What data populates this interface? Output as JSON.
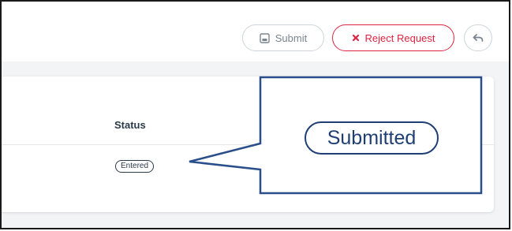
{
  "toolbar": {
    "submit_label": "Submit",
    "reject_label": "Reject Request"
  },
  "icons": {
    "submit": "inbox-icon",
    "reject": "close-icon",
    "back": "reply-icon"
  },
  "colors": {
    "reject": "#e0243f",
    "callout": "#1f3f74",
    "text_dark": "#2b3a4a"
  },
  "table": {
    "columns": [
      "Status"
    ],
    "rows": [
      {
        "status": "Entered"
      }
    ]
  },
  "callout": {
    "text": "Submitted"
  }
}
